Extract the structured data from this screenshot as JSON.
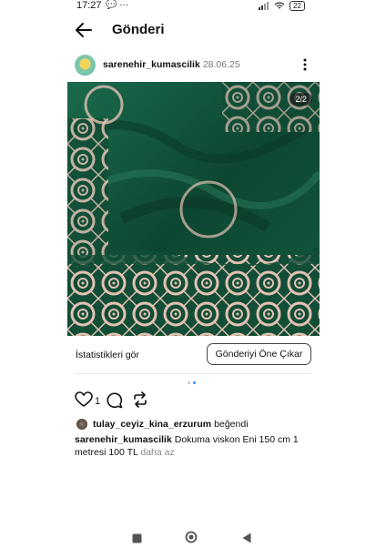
{
  "status_bar": {
    "time": "17:27",
    "notif_icons": "💬 ···",
    "battery": "22"
  },
  "header": {
    "title": "Gönderi"
  },
  "post": {
    "username": "sarenehir_kumascilik",
    "date": "28.06.25",
    "image_counter": "2/2",
    "stats_link": "İstatistikleri gör",
    "promote_button": "Gönderiyi Öne Çıkar",
    "like_count": "1",
    "liked_by_user": "tulay_ceyiz_kina_erzurum",
    "liked_by_text": "beğendi",
    "caption_user": "sarenehir_kumascilik",
    "caption_text": "Dokuma viskon Eni 150 cm 1 metresi 100 TL",
    "more_label": "daha az"
  },
  "colors": {
    "fabric_green": "#11503a",
    "lace": "#e2c2b3",
    "accent_blue": "#2a8df0"
  },
  "icons": [
    "back-arrow-icon",
    "more-vertical-icon",
    "heart-icon",
    "comment-icon",
    "repost-icon",
    "square-nav-icon",
    "circle-nav-icon",
    "triangle-back-icon"
  ]
}
